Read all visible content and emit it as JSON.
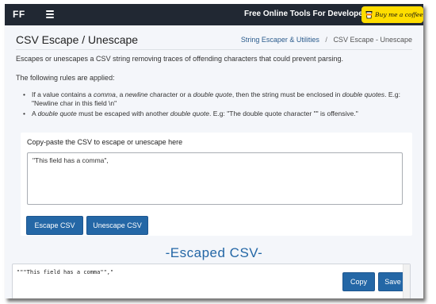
{
  "nav": {
    "logo": "FF",
    "site_title": "Free Online Tools For Developers",
    "coffee_label": "Buy me a coffee"
  },
  "page": {
    "title": "CSV Escape / Unescape",
    "breadcrumb": {
      "parent": "String Escaper & Utilities",
      "separator": "/",
      "current": "CSV Escape - Unescape"
    },
    "intro": "Escapes or unescapes a CSV string removing traces of offending characters that could prevent parsing.",
    "rules_intro": "The following rules are applied:",
    "rules": [
      {
        "p1": "If a value contains a ",
        "i1": "comma",
        "p2": ", a ",
        "i2": "newline",
        "p3": " character or a ",
        "i3": "double quote",
        "p4": ", then the string must be enclosed in ",
        "i4": "double quotes",
        "p5": ". E.g: \"Newline char in this field \\n\""
      },
      {
        "p1": "A ",
        "i1": "double quote",
        "p2": " must be escaped with another ",
        "i2": "double quote",
        "p3": ". E.g: \"The double quote character \"\" is offensive.\""
      }
    ]
  },
  "input_card": {
    "label": "Copy-paste the CSV to escape or unescape here",
    "value": "\"This field has a comma\",",
    "escape_button": "Escape CSV",
    "unescape_button": "Unescape CSV"
  },
  "output": {
    "section_title": "-Escaped CSV-",
    "value": "\"\"\"This field has a comma\"\",\"",
    "copy_button": "Copy",
    "save_button": "Save"
  },
  "colors": {
    "nav_bg": "#212833",
    "primary": "#2467a6",
    "coffee": "#ffdd00"
  }
}
